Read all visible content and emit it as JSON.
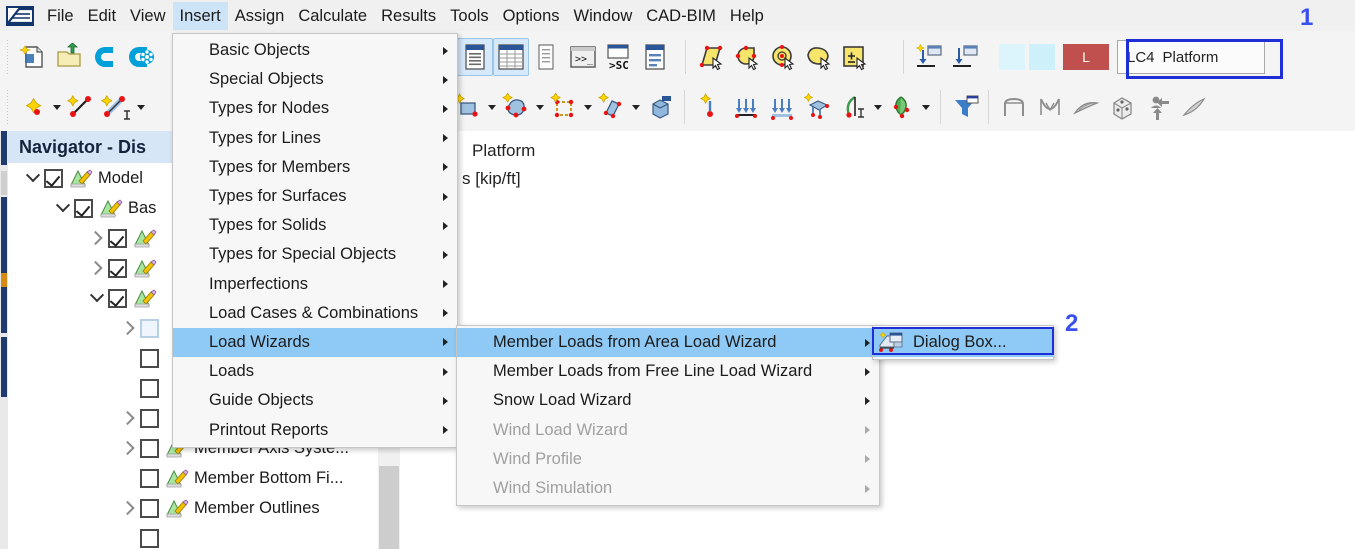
{
  "app": {
    "logo_icon": "rfem-logo-icon"
  },
  "menubar": {
    "items": [
      {
        "label": "File",
        "active": false
      },
      {
        "label": "Edit",
        "active": false
      },
      {
        "label": "View",
        "active": false
      },
      {
        "label": "Insert",
        "active": true
      },
      {
        "label": "Assign",
        "active": false
      },
      {
        "label": "Calculate",
        "active": false
      },
      {
        "label": "Results",
        "active": false
      },
      {
        "label": "Tools",
        "active": false
      },
      {
        "label": "Options",
        "active": false
      },
      {
        "label": "Window",
        "active": false
      },
      {
        "label": "CAD-BIM",
        "active": false
      },
      {
        "label": "Help",
        "active": false
      }
    ]
  },
  "toolbar_row1": {
    "icons": [
      "new-model-icon",
      "open-folder-icon",
      "cloud-c-icon",
      "cloud-network-icon",
      "table-list-icon",
      "table-grid-icon",
      "table-report-icon",
      "command-prompt-icon",
      "script-sc-icon",
      "table-info-icon",
      "select-polygon-icon",
      "select-lasso-icon",
      "select-circle-icon",
      "select-free-icon",
      "select-box-icon",
      "new-load-case-icon",
      "load-case-down-icon"
    ],
    "color_chips": [
      "#dcf4fb",
      "#cdf0fb"
    ],
    "load_marker_label": "L",
    "load_case": {
      "id": "LC4",
      "name": "Platform"
    }
  },
  "toolbar_row2": {
    "icons": [
      "node-icon",
      "line-icon",
      "line-dimension-icon",
      "surface-icon",
      "solid-icon",
      "opening-icon",
      "member-icon",
      "solid-block-icon",
      "nodal-support-icon",
      "line-support-icon",
      "member-support-icon",
      "surface-support-icon",
      "member-hinge-icon",
      "nodal-release-icon",
      "filter-icon",
      "frame-icon",
      "arch-icon",
      "shell-icon",
      "cube-icon",
      "move-icon",
      "stick-icon"
    ]
  },
  "navigator": {
    "title": "Navigator - Dis",
    "title_full": "Navigator - Display",
    "tree": [
      {
        "label": "Model",
        "indent": 0,
        "arrow": "down",
        "checked": true,
        "icon": "model-edit-icon"
      },
      {
        "label": "Bas",
        "indent": 1,
        "arrow": "down",
        "checked": true,
        "icon": "model-edit-icon"
      },
      {
        "label": "",
        "indent": 2,
        "arrow": "right",
        "checked": true,
        "icon": "model-edit-icon"
      },
      {
        "label": "",
        "indent": 2,
        "arrow": "right",
        "checked": true,
        "icon": "model-edit-icon"
      },
      {
        "label": "",
        "indent": 2,
        "arrow": "down",
        "checked": true,
        "icon": "model-edit-icon"
      },
      {
        "label": "",
        "indent": 3,
        "arrow": "right",
        "checked": false,
        "icon": "model-edit-icon",
        "ghost": true
      },
      {
        "label": "",
        "indent": 3,
        "arrow": "none",
        "checked": false,
        "icon": "model-edit-icon"
      },
      {
        "label": "",
        "indent": 3,
        "arrow": "none",
        "checked": false,
        "icon": "model-edit-icon"
      },
      {
        "label": "",
        "indent": 3,
        "arrow": "right",
        "checked": false,
        "icon": "model-edit-icon"
      },
      {
        "label": "Member Axis Syste...",
        "indent": 3,
        "arrow": "right",
        "checked": false,
        "icon": "model-edit-icon"
      },
      {
        "label": "Member Bottom Fi...",
        "indent": 3,
        "arrow": "none",
        "checked": false,
        "icon": "model-edit-icon"
      },
      {
        "label": "Member Outlines",
        "indent": 3,
        "arrow": "right",
        "checked": false,
        "icon": "model-edit-icon"
      }
    ]
  },
  "canvas": {
    "line1": "Platform",
    "line2": "s [kip/ft]"
  },
  "menu_insert": {
    "items": [
      {
        "label": "Basic Objects",
        "submenu": true,
        "disabled": false,
        "highlighted": false
      },
      {
        "label": "Special Objects",
        "submenu": true,
        "disabled": false,
        "highlighted": false
      },
      {
        "label": "Types for Nodes",
        "submenu": true,
        "disabled": false,
        "highlighted": false
      },
      {
        "label": "Types for Lines",
        "submenu": true,
        "disabled": false,
        "highlighted": false
      },
      {
        "label": "Types for Members",
        "submenu": true,
        "disabled": false,
        "highlighted": false
      },
      {
        "label": "Types for Surfaces",
        "submenu": true,
        "disabled": false,
        "highlighted": false
      },
      {
        "label": "Types for Solids",
        "submenu": true,
        "disabled": false,
        "highlighted": false
      },
      {
        "label": "Types for Special Objects",
        "submenu": true,
        "disabled": false,
        "highlighted": false
      },
      {
        "label": "Imperfections",
        "submenu": true,
        "disabled": false,
        "highlighted": false
      },
      {
        "label": "Load Cases & Combinations",
        "submenu": true,
        "disabled": false,
        "highlighted": false
      },
      {
        "label": "Load Wizards",
        "submenu": true,
        "disabled": false,
        "highlighted": true
      },
      {
        "label": "Loads",
        "submenu": true,
        "disabled": false,
        "highlighted": false
      },
      {
        "label": "Guide Objects",
        "submenu": true,
        "disabled": false,
        "highlighted": false
      },
      {
        "label": "Printout Reports",
        "submenu": true,
        "disabled": false,
        "highlighted": false
      }
    ]
  },
  "menu_load_wizards": {
    "items": [
      {
        "label": "Member Loads from Area Load Wizard",
        "submenu": true,
        "disabled": false,
        "highlighted": true
      },
      {
        "label": "Member Loads from Free Line Load Wizard",
        "submenu": true,
        "disabled": false,
        "highlighted": false
      },
      {
        "label": "Snow Load Wizard",
        "submenu": true,
        "disabled": false,
        "highlighted": false
      },
      {
        "label": "Wind Load Wizard",
        "submenu": true,
        "disabled": true,
        "highlighted": false
      },
      {
        "label": "Wind Profile",
        "submenu": true,
        "disabled": true,
        "highlighted": false
      },
      {
        "label": "Wind Simulation",
        "submenu": true,
        "disabled": true,
        "highlighted": false
      }
    ]
  },
  "menu_dialog": {
    "items": [
      {
        "label": "Dialog Box...",
        "submenu": false,
        "disabled": false,
        "highlighted": true,
        "icon": "area-load-wizard-icon"
      }
    ]
  },
  "annotations": [
    {
      "label": "1",
      "color": "#3a4ff0"
    },
    {
      "label": "2",
      "color": "#3a4ff0"
    }
  ],
  "highlights": [
    {
      "name": "load-case-combo-highlight",
      "color": "#1f2fd8"
    },
    {
      "name": "dialog-box-highlight",
      "color": "#1f2fd8"
    }
  ]
}
